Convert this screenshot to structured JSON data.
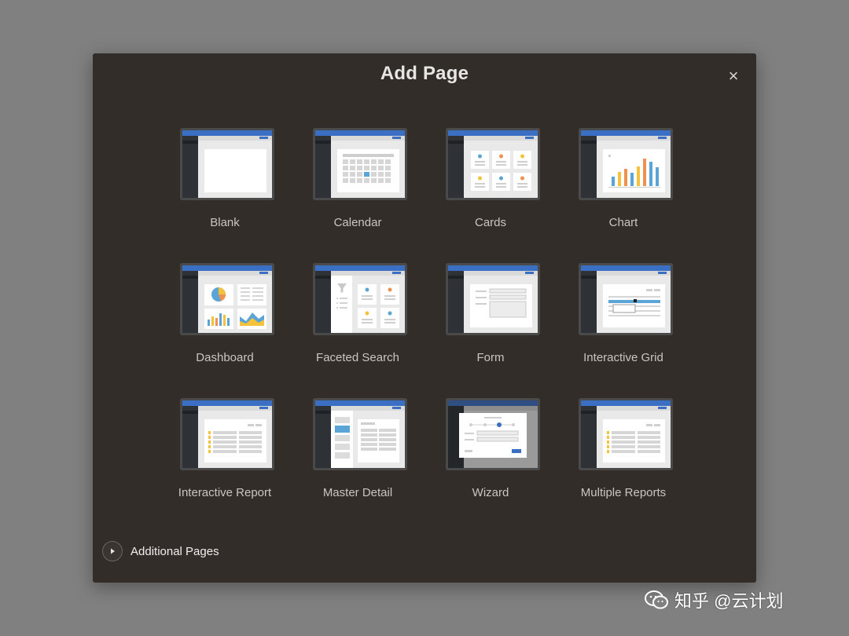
{
  "dialog": {
    "title": "Add Page",
    "close_symbol": "×"
  },
  "tiles": [
    {
      "label": "Blank",
      "icon": "blank-page-icon"
    },
    {
      "label": "Calendar",
      "icon": "calendar-page-icon"
    },
    {
      "label": "Cards",
      "icon": "cards-page-icon"
    },
    {
      "label": "Chart",
      "icon": "chart-page-icon"
    },
    {
      "label": "Dashboard",
      "icon": "dashboard-page-icon"
    },
    {
      "label": "Faceted Search",
      "icon": "faceted-search-page-icon"
    },
    {
      "label": "Form",
      "icon": "form-page-icon"
    },
    {
      "label": "Interactive Grid",
      "icon": "interactive-grid-page-icon"
    },
    {
      "label": "Interactive Report",
      "icon": "interactive-report-page-icon"
    },
    {
      "label": "Master Detail",
      "icon": "master-detail-page-icon"
    },
    {
      "label": "Wizard",
      "icon": "wizard-page-icon"
    },
    {
      "label": "Multiple Reports",
      "icon": "multiple-reports-page-icon"
    }
  ],
  "footer": {
    "additional_pages_label": "Additional Pages"
  },
  "watermark": {
    "text": "知乎 @云计划"
  },
  "colors": {
    "dialog_bg": "#322d29",
    "page_bg": "#808080",
    "header_blue": "#3b6fc4",
    "sidebar_dark": "#2e3236",
    "accent_blue": "#5ba4d6",
    "accent_orange": "#f0914f",
    "accent_yellow": "#f5c33b"
  }
}
